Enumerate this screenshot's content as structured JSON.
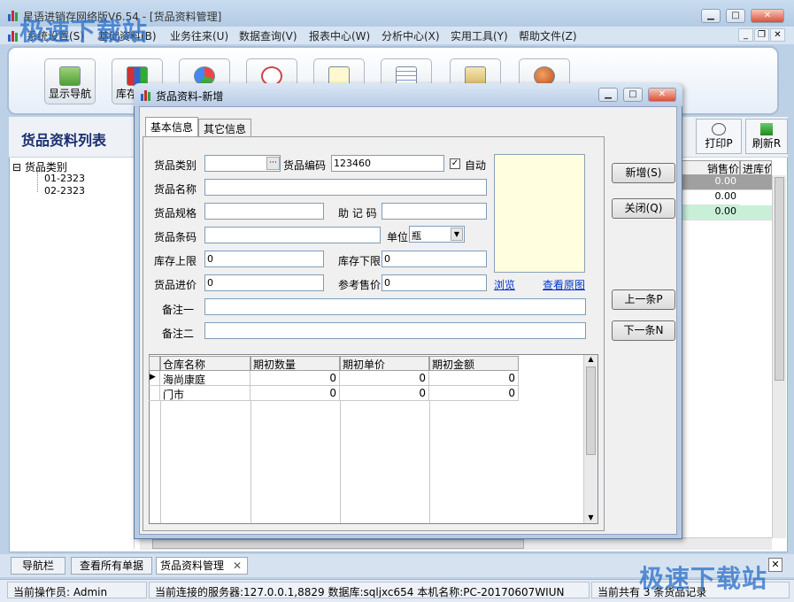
{
  "app": {
    "title": "星语进销存网络版V6.54 - [货品资料管理]",
    "menu": [
      "系统设置(S)",
      "基础资料(B)",
      "业务往来(U)",
      "数据查询(V)",
      "报表中心(W)",
      "分析中心(X)",
      "实用工具(Y)",
      "帮助文件(Z)"
    ],
    "toolbar": [
      {
        "label": "显示导航",
        "icon": "navigation-icon"
      },
      {
        "label": "库存",
        "icon": "stock-chart-icon"
      },
      {
        "label": "",
        "icon": "pie-chart-icon"
      },
      {
        "label": "",
        "icon": "clock-icon"
      },
      {
        "label": "",
        "icon": "search-doc-icon"
      },
      {
        "label": "",
        "icon": "table-icon"
      },
      {
        "label": "",
        "icon": "clipboard-icon"
      },
      {
        "label": "",
        "icon": "users-icon"
      }
    ]
  },
  "list": {
    "title": "货品资料列表",
    "tree_root": "货品类别",
    "tree_children": [
      "01-2323",
      "02-2323"
    ],
    "print_label": "打印P",
    "refresh_label": "刷新R",
    "col_sale": "销售价",
    "col_in": "进库价",
    "rows": [
      "0.00",
      "0.00",
      "0.00"
    ]
  },
  "dialog": {
    "title": "货品资料-新增",
    "tabs": [
      "基本信息",
      "其它信息"
    ],
    "labels": {
      "category": "货品类别",
      "code": "货品编码",
      "auto": "自动",
      "name": "货品名称",
      "spec": "货品规格",
      "memo_code": "助 记 码",
      "barcode": "货品条码",
      "unit": "单位",
      "stock_upper": "库存上限",
      "stock_lower": "库存下限",
      "purchase_price": "货品进价",
      "ref_price": "参考售价",
      "note1": "备注一",
      "note2": "备注二",
      "browse": "浏览",
      "view_original": "查看原图"
    },
    "values": {
      "category": "",
      "code": "123460",
      "auto_checked": true,
      "name": "",
      "spec": "",
      "memo_code": "",
      "barcode": "",
      "unit": "瓶",
      "stock_upper": "0",
      "stock_lower": "0",
      "purchase_price": "0",
      "ref_price": "0",
      "note1": "",
      "note2": ""
    },
    "buttons": {
      "new": "新增(S)",
      "close": "关闭(Q)",
      "prev": "上一条P",
      "next": "下一条N"
    },
    "grid": {
      "columns": [
        "仓库名称",
        "期初数量",
        "期初单价",
        "期初金额"
      ],
      "rows": [
        [
          "海尚康庭",
          "0",
          "0",
          "0"
        ],
        [
          "门市",
          "0",
          "0",
          "0"
        ]
      ]
    }
  },
  "bottom_tabs": [
    "导航栏",
    "查看所有单据",
    "货品资料管理"
  ],
  "status": {
    "operator": "当前操作员: Admin",
    "connection": "当前连接的服务器:127.0.0.1,8829 数据库:sqljxc654 本机名称:PC-20170607WIUN",
    "count": "当前共有 3 条货品记录"
  },
  "watermark": "极速下载站",
  "colors": {
    "accent": "#1a2f6e",
    "selected_row": "#a0a0a0",
    "highlight_row": "#c8f0d8",
    "photo_bg": "#ffffe0"
  }
}
